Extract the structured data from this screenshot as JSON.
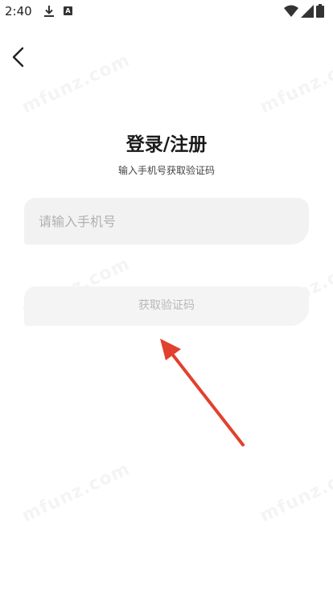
{
  "status_bar": {
    "time": "2:40"
  },
  "header": {
    "title": "登录/注册",
    "subtitle": "输入手机号获取验证码"
  },
  "phone_input": {
    "placeholder": "请输入手机号",
    "value": ""
  },
  "get_code_button": {
    "label": "获取验证码"
  },
  "watermark": {
    "text": "mfunz.com"
  },
  "colors": {
    "arrow": "#e2412e",
    "field_bg": "#f2f2f2",
    "button_text": "#b8b8b8"
  }
}
